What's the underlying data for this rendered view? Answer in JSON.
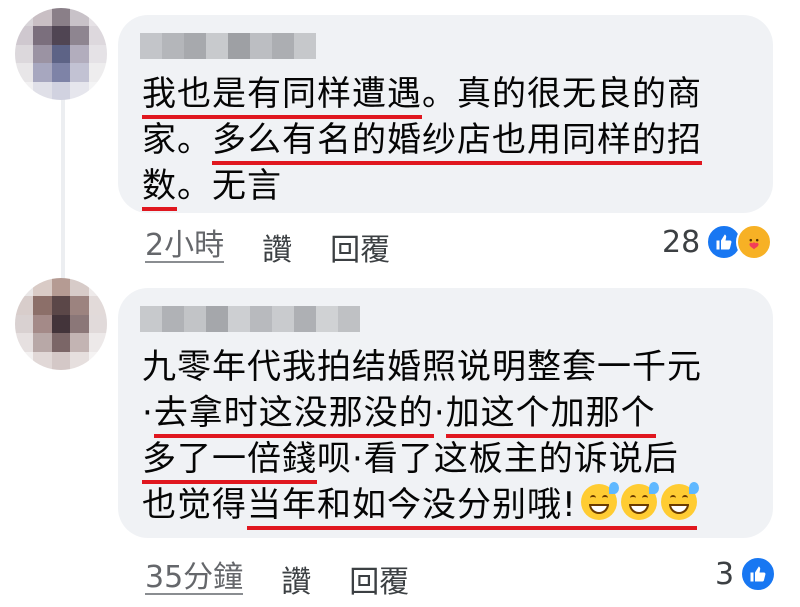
{
  "comments": [
    {
      "lines": [
        [
          "我也是有同样遭遇",
          "。真的很无良的商"
        ],
        [
          "家。",
          "多么有名的婚纱店也用同样的招"
        ],
        [
          "数",
          "。无言"
        ]
      ],
      "time": "2小時",
      "like_label": "讚",
      "reply_label": "回覆",
      "reaction_count": "28",
      "reaction_icons": [
        "like-icon",
        "care-icon"
      ]
    },
    {
      "lines": [
        [
          "九零年代我拍结婚照说明整套一千元"
        ],
        [
          "·",
          "去拿时这没那没的",
          "·",
          "加这个加那个"
        ],
        [
          "多了一倍錢",
          "呗·看了这板主的诉说后"
        ],
        [
          "也觉得",
          "当年和如今没分别哦!"
        ]
      ],
      "time": "35分鐘",
      "like_label": "讚",
      "reply_label": "回覆",
      "reaction_count": "3",
      "reaction_icons": [
        "like-icon"
      ],
      "emojis": [
        "sweat-smile-emoji",
        "sweat-smile-emoji",
        "sweat-smile-emoji"
      ]
    }
  ],
  "colors": {
    "bubble": "#f0f2f5",
    "underline": "#e0171f",
    "like": "#1877f2",
    "text": "#050505"
  }
}
